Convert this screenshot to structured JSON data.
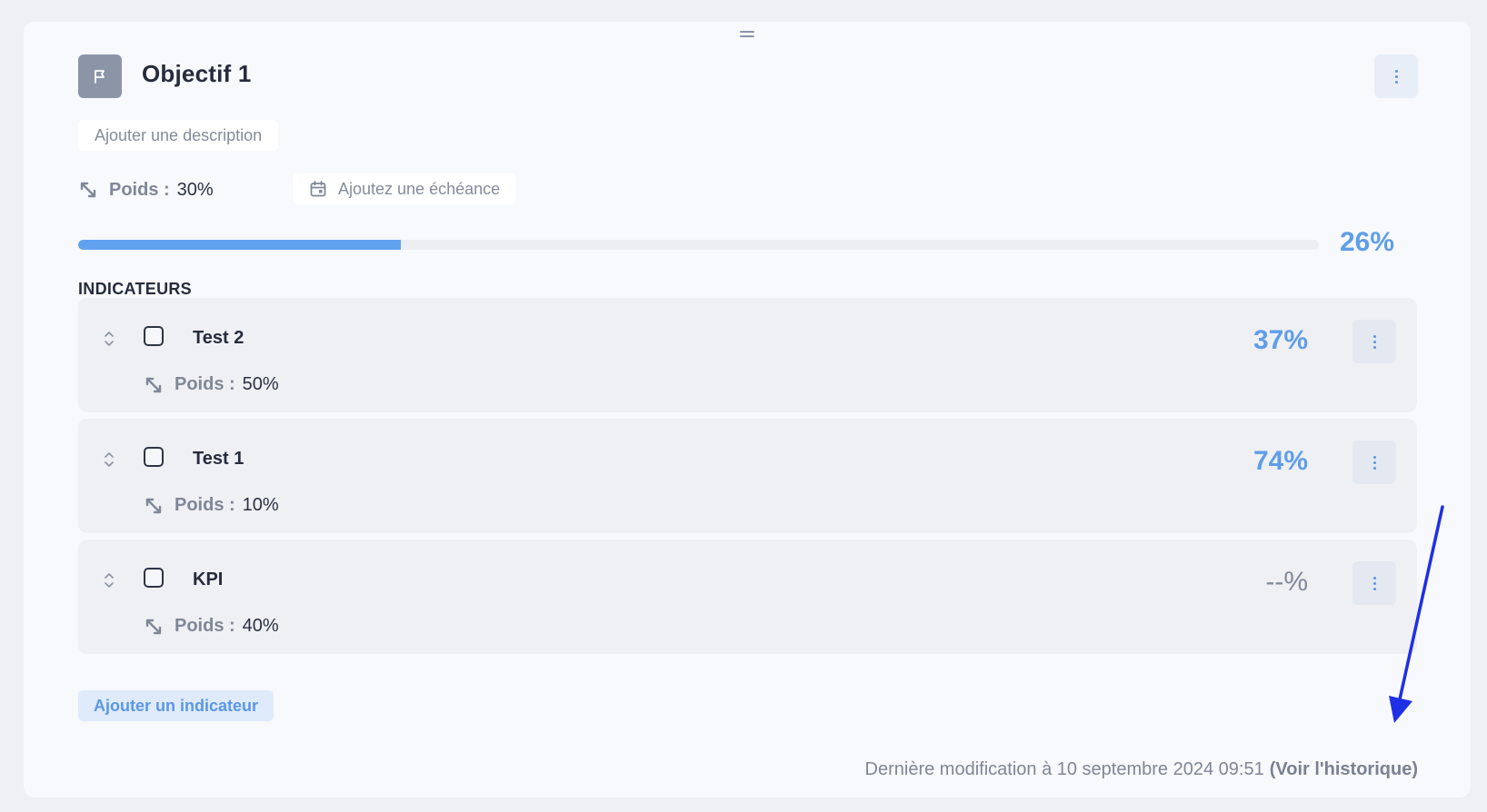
{
  "objective": {
    "title": "Objectif 1",
    "description_placeholder": "Ajouter une description",
    "weight_label": "Poids :",
    "weight_value": "30%",
    "deadline_placeholder": "Ajoutez une échéance",
    "progress_percent": 26,
    "progress_label": "26%"
  },
  "indicators_section": {
    "title": "INDICATEURS",
    "items": [
      {
        "name": "Test 2",
        "weight_label": "Poids :",
        "weight_value": "50%",
        "percent_label": "37%",
        "checked": false
      },
      {
        "name": "Test 1",
        "weight_label": "Poids :",
        "weight_value": "10%",
        "percent_label": "74%",
        "checked": false
      },
      {
        "name": "KPI",
        "weight_label": "Poids :",
        "weight_value": "40%",
        "percent_label": "--%",
        "checked": false
      }
    ],
    "add_button_label": "Ajouter un indicateur"
  },
  "footer": {
    "last_modified_text": "Dernière modification à 10 septembre 2024 09:51",
    "history_link_label": "(Voir l'historique)"
  },
  "colors": {
    "accent": "#5f9ee8",
    "progress_fill": "#60a2f0",
    "annotation_arrow": "#1f2fe6"
  },
  "icons": [
    "drag-handle-icon",
    "flag-icon",
    "more-vertical-icon",
    "weight-resize-icon",
    "calendar-icon",
    "sort-updown-icon"
  ]
}
